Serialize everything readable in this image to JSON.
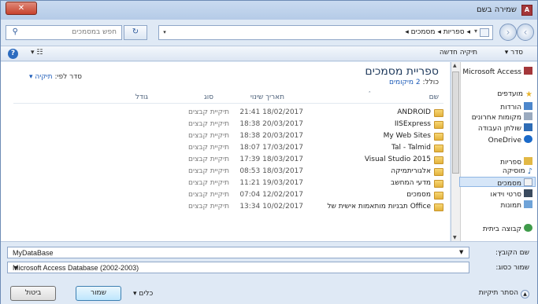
{
  "window": {
    "title": "שמירה בשם",
    "app_icon": "A",
    "close": "✕"
  },
  "address": {
    "breadcrumb": "◂ ספריות ◂ מסמכים ◂",
    "search_placeholder": "חפש במסמכים",
    "back_icon": "back-arrow-icon",
    "forward_icon": "forward-arrow-icon"
  },
  "toolbar": {
    "organize": "סדר ▾",
    "new_folder": "תיקיה חדשה",
    "views": "☷ ▾",
    "help": "?"
  },
  "nav": {
    "items": [
      {
        "label": "Microsoft Access",
        "icon": "access-icon"
      },
      {
        "label": "מועדפים",
        "icon": "star-icon"
      },
      {
        "label": "הורדות",
        "icon": "download-folder-icon"
      },
      {
        "label": "מקומות אחרונים",
        "icon": "recent-places-icon"
      },
      {
        "label": "שולחן העבודה",
        "icon": "desktop-icon"
      },
      {
        "label": "OneDrive",
        "icon": "cloud-icon"
      },
      {
        "label": "ספריות",
        "icon": "libraries-icon"
      },
      {
        "label": "מוסיקה",
        "icon": "music-icon"
      },
      {
        "label": "מסמכים",
        "icon": "documents-icon"
      },
      {
        "label": "סרטי וידאו",
        "icon": "video-icon"
      },
      {
        "label": "תמונות",
        "icon": "pictures-icon"
      },
      {
        "label": "קבוצה ביתית",
        "icon": "homegroup-icon"
      }
    ]
  },
  "library": {
    "title": "ספריית מסמכים",
    "includes_prefix": "כולל:",
    "includes_link": "2 מיקומים",
    "arrange_prefix": "סדר לפי:",
    "arrange_value": "תיקיה ▾"
  },
  "columns": {
    "name": "שם",
    "date": "תאריך שינוי",
    "type": "סוג",
    "size": "גודל"
  },
  "files": [
    {
      "name": "ANDROID",
      "date": "18/02/2017 21:41",
      "type": "תיקיית קבצים"
    },
    {
      "name": "IISExpress",
      "date": "20/03/2017 18:38",
      "type": "תיקיית קבצים"
    },
    {
      "name": "My Web Sites",
      "date": "20/03/2017 18:38",
      "type": "תיקיית קבצים"
    },
    {
      "name": "Tal - Talmid",
      "date": "17/03/2017 18:07",
      "type": "תיקיית קבצים"
    },
    {
      "name": "Visual Studio 2015",
      "date": "18/03/2017 17:39",
      "type": "תיקיית קבצים"
    },
    {
      "name": "אלגוריתמיקה",
      "date": "18/03/2017 08:53",
      "type": "תיקיית קבצים"
    },
    {
      "name": "מדעי המחשב",
      "date": "19/03/2017 11:21",
      "type": "תיקיית קבצים"
    },
    {
      "name": "מסמכים",
      "date": "12/02/2017 07:04",
      "type": "תיקיית קבצים"
    },
    {
      "name": "Office תבניות מותאמות אישית של",
      "date": "10/02/2017 13:34",
      "type": "תיקיית קבצים"
    }
  ],
  "form": {
    "file_name_label": "שם הקובץ:",
    "file_name_value": "MyDataBase",
    "save_type_label": "שמור כסוג:",
    "save_type_value": "Microsoft Access Database (2002-2003)",
    "hide_folders": "הסתר תיקיות",
    "tools": "כלים",
    "save": "שמור",
    "cancel": "ביטול"
  }
}
